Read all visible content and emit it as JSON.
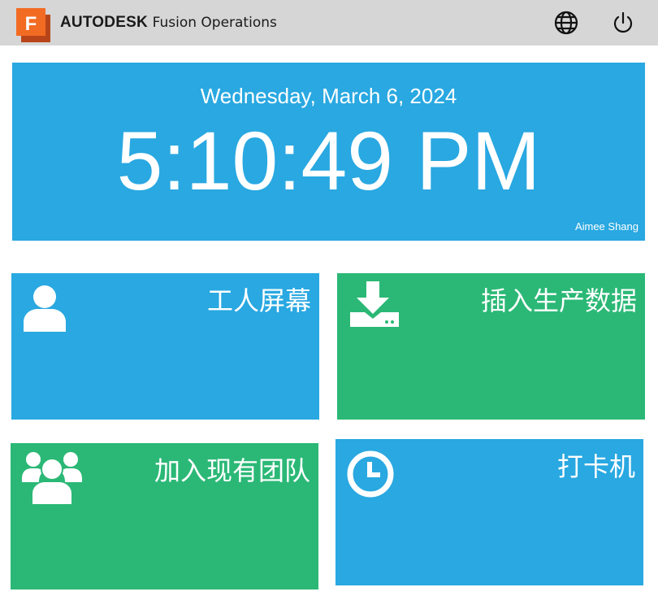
{
  "header": {
    "brand_bold": "AUTODESK",
    "brand_rest": "Fusion Operations",
    "logo_letter": "F",
    "globe_icon": "globe-icon",
    "power_icon": "power-icon"
  },
  "clock": {
    "date": "Wednesday, March 6, 2024",
    "time": "5:10:49 PM",
    "user": "Aimee Shang"
  },
  "tiles": [
    {
      "label": "工人屏幕",
      "icon": "user-icon",
      "color": "#29a8e1"
    },
    {
      "label": "插入生产数据",
      "icon": "download-icon",
      "color": "#2bb876"
    },
    {
      "label": "加入现有团队",
      "icon": "group-icon",
      "color": "#2bb876"
    },
    {
      "label": "打卡机",
      "icon": "clock-icon",
      "color": "#29a8e1"
    }
  ],
  "colors": {
    "blue": "#29a8e1",
    "green": "#2bb876",
    "header_bg": "#d6d6d6",
    "logo_orange": "#f26b22"
  }
}
